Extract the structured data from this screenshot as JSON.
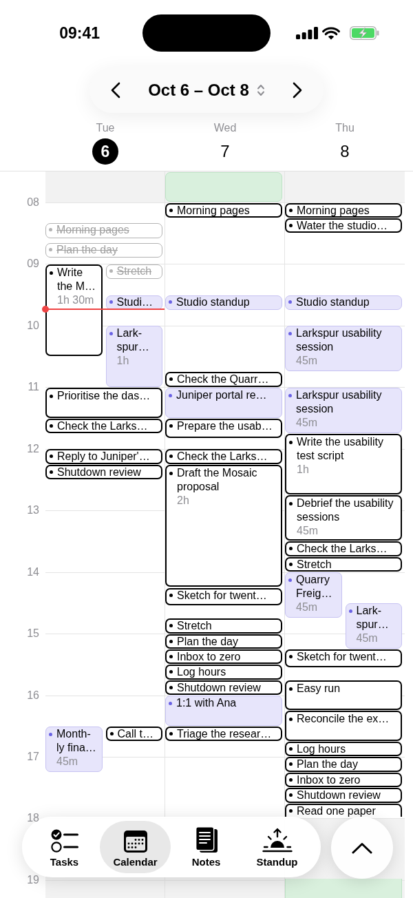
{
  "status_bar": {
    "time": "09:41"
  },
  "date_range": {
    "label": "Oct 6 – Oct 8"
  },
  "hours": [
    "08",
    "09",
    "10",
    "11",
    "12",
    "13",
    "14",
    "15",
    "16",
    "17",
    "18",
    "19"
  ],
  "days": [
    {
      "weekday": "Tue",
      "date": "6",
      "selected": true,
      "now_line": true,
      "events": [
        {
          "kind": "task",
          "title": "Morning pages",
          "done": true
        },
        {
          "kind": "task",
          "title": "Plan the day",
          "done": true
        },
        {
          "kind": "task",
          "title": "Write the M…",
          "duration": "1h 30m",
          "done": false
        },
        {
          "kind": "task",
          "title": "Stretch",
          "done": true
        },
        {
          "kind": "meeting",
          "title": "Studi…",
          "done": false
        },
        {
          "kind": "meeting",
          "title": "Lark-spur…",
          "duration": "1h",
          "done": false
        },
        {
          "kind": "task",
          "title": "Prioritise the das…",
          "done": false
        },
        {
          "kind": "task",
          "title": "Check the Larks…",
          "done": false
        },
        {
          "kind": "task",
          "title": "Reply to Juniper'…",
          "done": false
        },
        {
          "kind": "task",
          "title": "Shutdown review",
          "done": false
        },
        {
          "kind": "meeting",
          "title": "Month-ly fina…",
          "duration": "45m",
          "done": false
        },
        {
          "kind": "task",
          "title": "Call t…",
          "done": false
        }
      ]
    },
    {
      "weekday": "Wed",
      "date": "7",
      "selected": false,
      "events": [
        {
          "kind": "block",
          "done": false
        },
        {
          "kind": "task",
          "title": "Morning pages",
          "done": false
        },
        {
          "kind": "meeting",
          "title": "Studio standup",
          "done": false
        },
        {
          "kind": "task",
          "title": "Check the Quarr…",
          "done": false
        },
        {
          "kind": "meeting",
          "title": "Juniper portal re…",
          "done": false
        },
        {
          "kind": "task",
          "title": "Prepare the usab…",
          "done": false
        },
        {
          "kind": "task",
          "title": "Check the Larks…",
          "done": false
        },
        {
          "kind": "task",
          "title": "Draft the Mosaic proposal",
          "duration": "2h",
          "done": false
        },
        {
          "kind": "task",
          "title": "Sketch for twent…",
          "done": false
        },
        {
          "kind": "task",
          "title": "Stretch",
          "done": false
        },
        {
          "kind": "task",
          "title": "Plan the day",
          "done": false
        },
        {
          "kind": "task",
          "title": "Inbox to zero",
          "done": false
        },
        {
          "kind": "task",
          "title": "Log hours",
          "done": false
        },
        {
          "kind": "task",
          "title": "Shutdown review",
          "done": false
        },
        {
          "kind": "meeting",
          "title": "1:1 with Ana",
          "done": false
        },
        {
          "kind": "task",
          "title": "Triage the resear…",
          "done": false
        }
      ]
    },
    {
      "weekday": "Thu",
      "date": "8",
      "selected": false,
      "events": [
        {
          "kind": "task",
          "title": "Morning pages",
          "done": false
        },
        {
          "kind": "task",
          "title": "Water the studio…",
          "done": false
        },
        {
          "kind": "meeting",
          "title": "Studio standup",
          "done": false
        },
        {
          "kind": "meeting",
          "title": "Larkspur usability session",
          "duration": "45m",
          "done": false
        },
        {
          "kind": "meeting",
          "title": "Larkspur usability session",
          "duration": "45m",
          "done": false
        },
        {
          "kind": "task",
          "title": "Write the usability test script",
          "duration": "1h",
          "done": false
        },
        {
          "kind": "task",
          "title": "Debrief the usability sessions",
          "duration": "45m",
          "done": false
        },
        {
          "kind": "task",
          "title": "Check the Larks…",
          "done": false
        },
        {
          "kind": "task",
          "title": "Stretch",
          "done": false
        },
        {
          "kind": "meeting",
          "title": "Quarry Freig…",
          "duration": "45m",
          "done": false
        },
        {
          "kind": "meeting",
          "title": "Lark-spur…",
          "duration": "45m",
          "done": false
        },
        {
          "kind": "task",
          "title": "Sketch for twent…",
          "done": false
        },
        {
          "kind": "task",
          "title": "Easy run",
          "done": false
        },
        {
          "kind": "task",
          "title": "Reconcile the ex…",
          "done": false
        },
        {
          "kind": "task",
          "title": "Log hours",
          "done": false
        },
        {
          "kind": "task",
          "title": "Plan the day",
          "done": false
        },
        {
          "kind": "task",
          "title": "Inbox to zero",
          "done": false
        },
        {
          "kind": "task",
          "title": "Shutdown review",
          "done": false
        },
        {
          "kind": "task",
          "title": "Read one paper",
          "done": false
        },
        {
          "kind": "block",
          "done": false
        }
      ]
    }
  ],
  "tab_bar": {
    "tabs": [
      {
        "kind": "tasks",
        "label": "Tasks",
        "selected": false
      },
      {
        "kind": "calendar",
        "label": "Calendar",
        "selected": true
      },
      {
        "kind": "notes",
        "label": "Notes",
        "selected": false
      },
      {
        "kind": "standup",
        "label": "Standup",
        "selected": false
      }
    ]
  }
}
